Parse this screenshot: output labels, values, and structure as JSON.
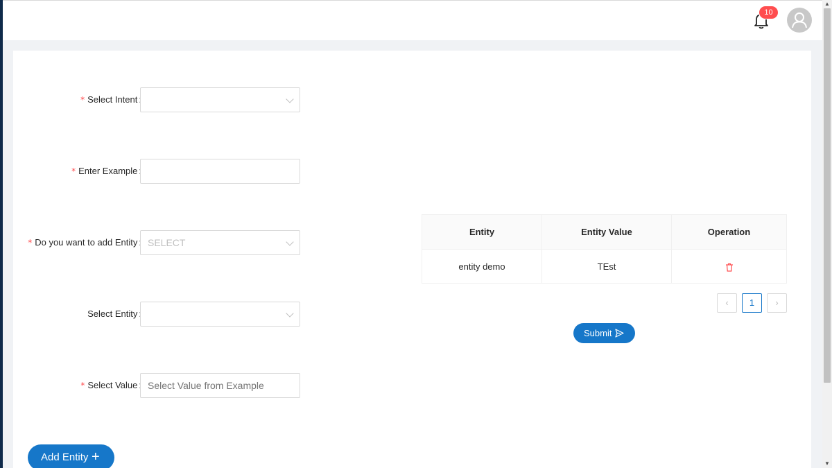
{
  "header": {
    "notification_count": "10"
  },
  "form": {
    "intent": {
      "label": "Select Intent",
      "required": true,
      "value": ""
    },
    "example": {
      "label": "Enter Example",
      "required": true,
      "value": ""
    },
    "add_entity": {
      "label": "Do you want to add Entity",
      "required": true,
      "placeholder": "SELECT"
    },
    "entity": {
      "label": "Select Entity",
      "required": false,
      "value": ""
    },
    "value": {
      "label": "Select Value",
      "required": true,
      "placeholder": "Select Value from Example"
    },
    "add_entity_button": "Add Entity"
  },
  "table": {
    "columns": [
      "Entity",
      "Entity Value",
      "Operation"
    ],
    "rows": [
      {
        "entity": "entity demo",
        "entity_value": "TEst",
        "operation": "delete-icon"
      }
    ]
  },
  "pagination": {
    "current_page": "1"
  },
  "submit_button": "Submit",
  "colors": {
    "primary": "#1677c9",
    "required_mark": "#ff4d4f",
    "badge": "#ff4d4f",
    "delete_icon": "#ff4d4f"
  }
}
